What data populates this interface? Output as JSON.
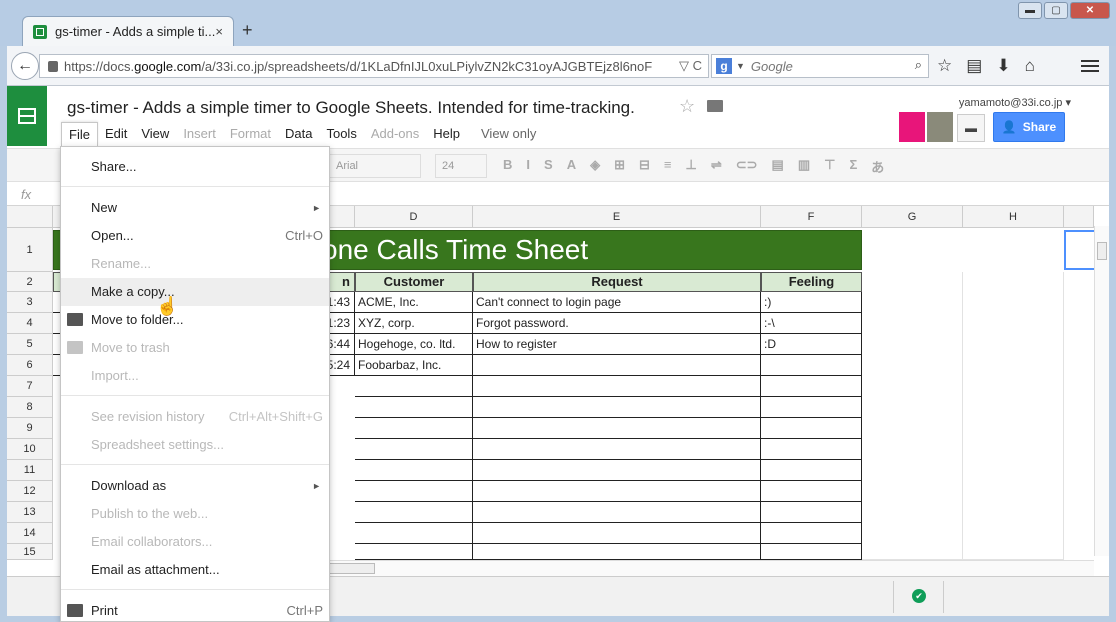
{
  "browser": {
    "tab_title": "gs-timer - Adds a simple ti...",
    "tab_close": "×",
    "new_tab": "+",
    "window_buttons": {
      "minimize": "▬",
      "maximize": "▢",
      "close": "✕"
    },
    "url_domain_prefix": "https://docs.",
    "url_domain": "google.com",
    "url_rest": "/a/33i.co.jp/spreadsheets/d/1KLaDfnIJL0xuLPiylvZN2kC31oyAJGBTEjz8l6noF",
    "url_tail": "▽ C",
    "search_engine_letter": "g",
    "search_placeholder": "Google",
    "search_icon": "⌕",
    "nav_icons": [
      "☆",
      "▤",
      "⬇",
      "⌂"
    ],
    "back": "←"
  },
  "docs": {
    "title": "gs-timer - Adds a simple timer to Google Sheets. Intended for time-tracking.",
    "star": "☆",
    "user_email": "yamamoto@33i.co.jp ▾",
    "chat_icon": "▬",
    "share_label": "Share",
    "menu": [
      {
        "label": "File",
        "state": "active"
      },
      {
        "label": "Edit",
        "state": "normal"
      },
      {
        "label": "View",
        "state": "normal"
      },
      {
        "label": "Insert",
        "state": "disabled"
      },
      {
        "label": "Format",
        "state": "disabled"
      },
      {
        "label": "Data",
        "state": "normal"
      },
      {
        "label": "Tools",
        "state": "normal"
      },
      {
        "label": "Add-ons",
        "state": "disabled"
      },
      {
        "label": "Help",
        "state": "normal"
      },
      {
        "label": "View only",
        "state": "info"
      }
    ],
    "toolbar": {
      "font": "Arial",
      "font_size": "24",
      "icons": [
        "B",
        "I",
        "S",
        "A",
        "◈",
        "⊞",
        "⊟",
        "≡",
        "⊥",
        "⇌",
        "⊂⊃",
        "▤",
        "▥",
        "⊤",
        "Σ",
        "あ"
      ]
    },
    "fx": "fx"
  },
  "sheet": {
    "columns": [
      "D",
      "E",
      "F",
      "G",
      "H"
    ],
    "rows": [
      "1",
      "2",
      "3",
      "4",
      "5",
      "6",
      "7",
      "8",
      "9",
      "10",
      "11",
      "12",
      "13",
      "14",
      "15"
    ],
    "banner": "one Calls Time Sheet",
    "headers": [
      "n",
      "Customer",
      "Request",
      "Feeling"
    ],
    "data": [
      [
        "1:43",
        "ACME, Inc.",
        "Can't connect to login page",
        ":)"
      ],
      [
        "1:23",
        "XYZ, corp.",
        "Forgot password.",
        ":-\\"
      ],
      [
        "6:44",
        "Hogehoge, co. ltd.",
        "How to register",
        ":D"
      ],
      [
        "5:24",
        "Foobarbaz, Inc.",
        "",
        ""
      ]
    ]
  },
  "file_menu": {
    "items": [
      {
        "label": "Share...",
        "shortcut": "",
        "disabled": false
      },
      {
        "label": "New",
        "shortcut": "",
        "disabled": false,
        "submenu": "►"
      },
      {
        "label": "Open...",
        "shortcut": "Ctrl+O",
        "disabled": false
      },
      {
        "label": "Rename...",
        "shortcut": "",
        "disabled": true
      },
      {
        "label": "Make a copy...",
        "shortcut": "",
        "disabled": false
      },
      {
        "label": "Move to folder...",
        "shortcut": "",
        "disabled": false
      },
      {
        "label": "Move to trash",
        "shortcut": "",
        "disabled": true
      },
      {
        "label": "Import...",
        "shortcut": "",
        "disabled": true
      },
      {
        "label": "See revision history",
        "shortcut": "Ctrl+Alt+Shift+G",
        "disabled": true
      },
      {
        "label": "Spreadsheet settings...",
        "shortcut": "",
        "disabled": true
      },
      {
        "label": "Download as",
        "shortcut": "",
        "disabled": false,
        "submenu": "►"
      },
      {
        "label": "Publish to the web...",
        "shortcut": "",
        "disabled": true
      },
      {
        "label": "Email collaborators...",
        "shortcut": "",
        "disabled": true
      },
      {
        "label": "Email as attachment...",
        "shortcut": "",
        "disabled": false
      },
      {
        "label": "Print",
        "shortcut": "Ctrl+P",
        "disabled": false
      }
    ]
  },
  "status": {
    "check": "✔"
  },
  "colors": {
    "banner": "#38761d",
    "header_row": "#d9ead3",
    "share": "#4d90fe",
    "sheets_green": "#1e8e3e"
  }
}
